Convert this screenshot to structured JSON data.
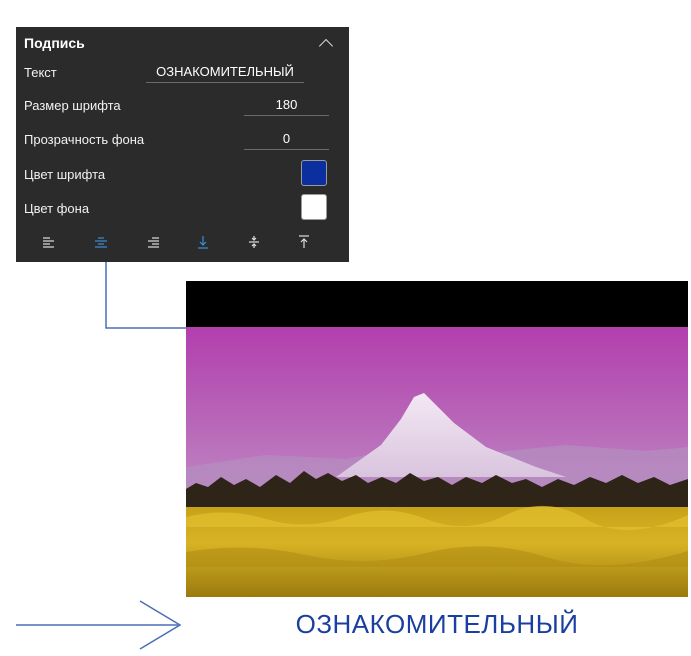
{
  "panel": {
    "title": "Подпись",
    "rows": {
      "text": {
        "label": "Текст",
        "value": "ОЗНАКОМИТЕЛЬНЫЙ"
      },
      "font_size": {
        "label": "Размер шрифта",
        "value": "180"
      },
      "bg_opacity": {
        "label": "Прозрачность фона",
        "value": "0"
      },
      "font_color": {
        "label": "Цвет шрифта",
        "color": "#0b2f9e"
      },
      "bg_color": {
        "label": "Цвет фона",
        "color": "#ffffff"
      }
    },
    "alignment_icons": [
      "align-left-icon",
      "align-center-icon",
      "align-right-icon",
      "align-bottom-icon",
      "align-middle-icon",
      "align-top-icon"
    ],
    "accent_color": "#3a8fd8"
  },
  "preview": {
    "caption": "ОЗНАКОМИТЕЛЬНЫЙ",
    "caption_color": "#1b3fa0"
  }
}
